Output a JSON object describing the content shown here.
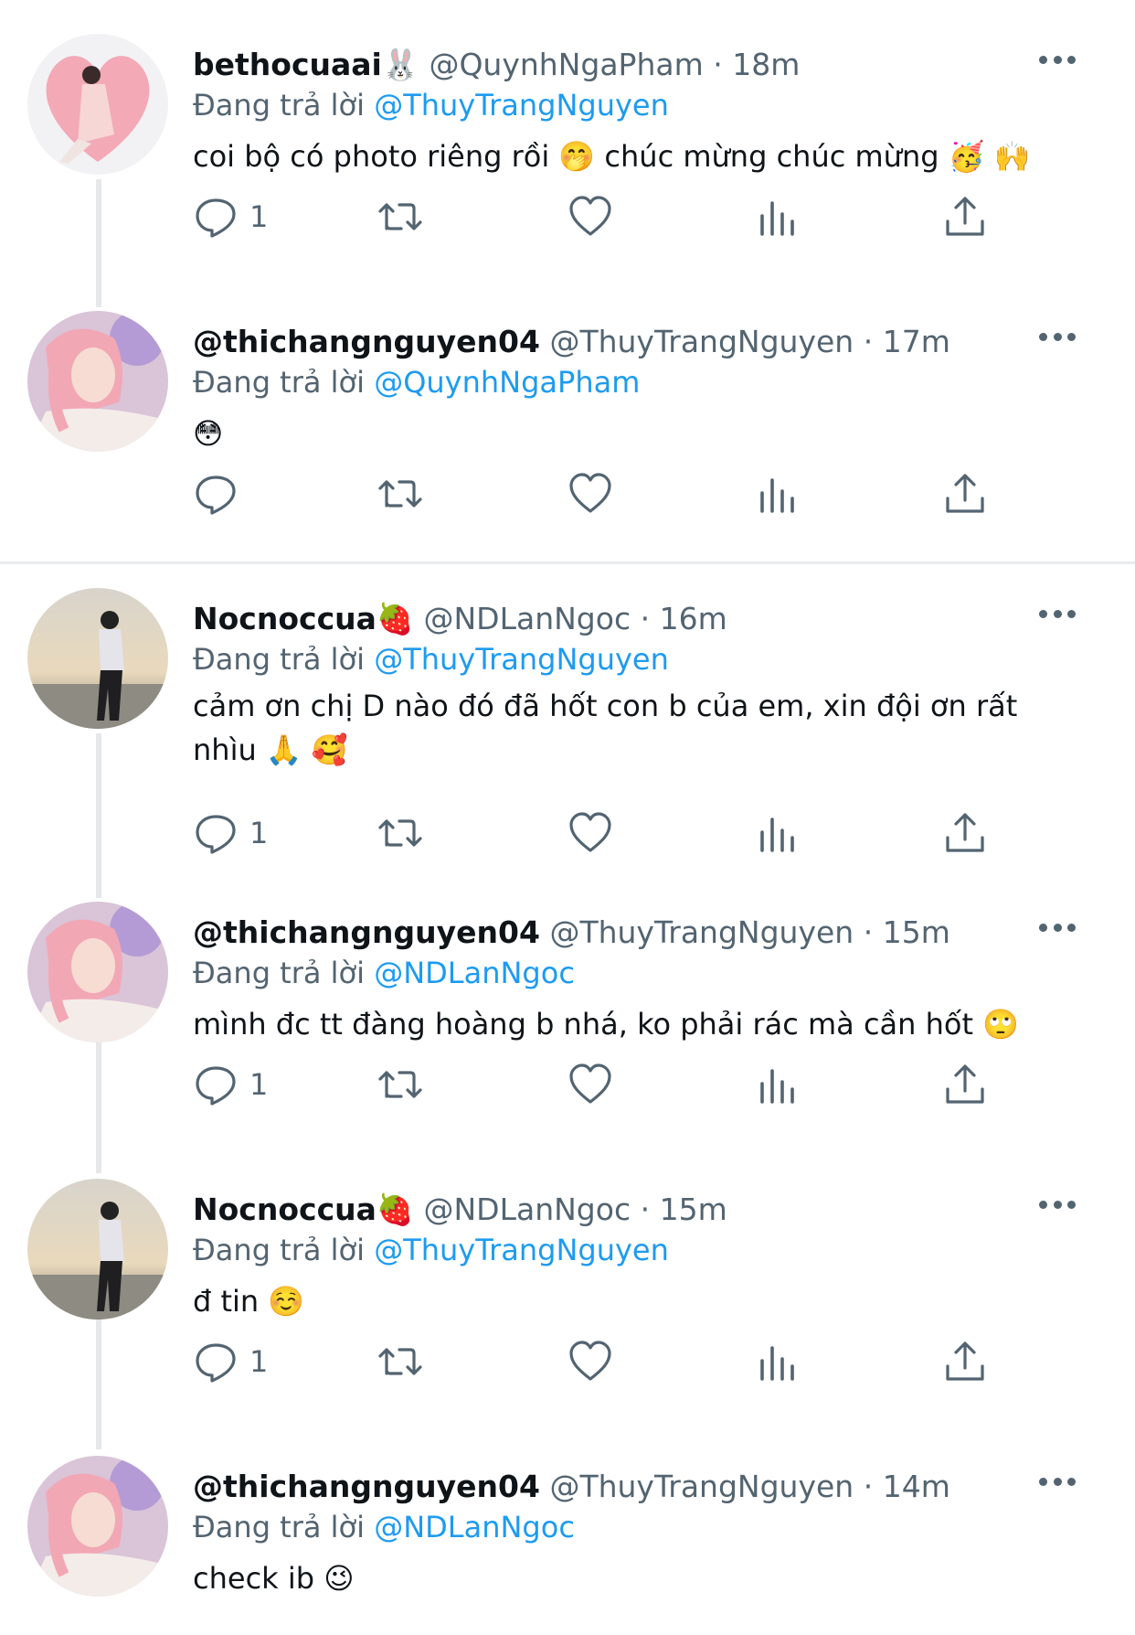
{
  "tweets": [
    {
      "display_name": "bethocuaai",
      "name_emoji": "🐰",
      "handle": "@QuynhNgaPham",
      "time": "· 18m",
      "replying_label": "Đang trả lời",
      "replying_to": "@ThuyTrangNguyen",
      "text": "coi bộ có photo riêng rồi 🤭  chúc mừng chúc mừng 🥳  🙌",
      "reply_count": "1",
      "avatar": "avatar-pink-heart"
    },
    {
      "display_name": "@thichangnguyen04",
      "name_emoji": "",
      "handle": "@ThuyTrangNguyen",
      "time": "· 17m",
      "replying_label": "Đang trả lời",
      "replying_to": "@QuynhNgaPham",
      "text": "😳",
      "reply_count": "",
      "avatar": "avatar-pink-hair"
    },
    {
      "display_name": "Nocnoccua",
      "name_emoji": "🍓",
      "handle": "@NDLanNgoc",
      "time": "· 16m",
      "replying_label": "Đang trả lời",
      "replying_to": "@ThuyTrangNguyen",
      "text": "cảm ơn chị D nào đó đã hốt con b của em, xin đội ơn rất nhìu 🙏  🥰",
      "reply_count": "1",
      "avatar": "avatar-sunset"
    },
    {
      "display_name": "@thichangnguyen04",
      "name_emoji": "",
      "handle": "@ThuyTrangNguyen",
      "time": "· 15m",
      "replying_label": "Đang trả lời",
      "replying_to": "@NDLanNgoc",
      "text": "mình đc tt đàng hoàng b nhá, ko phải rác mà cần hốt 🙄",
      "reply_count": "1",
      "avatar": "avatar-pink-hair"
    },
    {
      "display_name": "Nocnoccua",
      "name_emoji": "🍓",
      "handle": "@NDLanNgoc",
      "time": "· 15m",
      "replying_label": "Đang trả lời",
      "replying_to": "@ThuyTrangNguyen",
      "text": "đ tin ☺️",
      "reply_count": "1",
      "avatar": "avatar-sunset"
    },
    {
      "display_name": "@thichangnguyen04",
      "name_emoji": "",
      "handle": "@ThuyTrangNguyen",
      "time": "· 14m",
      "replying_label": "Đang trả lời",
      "replying_to": "@NDLanNgoc",
      "text": "check ib 😉",
      "reply_count": "",
      "avatar": "avatar-pink-hair"
    }
  ],
  "icons": {
    "reply": "reply-icon",
    "retweet": "retweet-icon",
    "like": "heart-icon",
    "views": "views-icon",
    "share": "share-icon",
    "more": "more-icon"
  },
  "colors": {
    "mention": "#1d9bf0",
    "secondary_text": "#536471",
    "thread_line": "#e6e8ea"
  }
}
